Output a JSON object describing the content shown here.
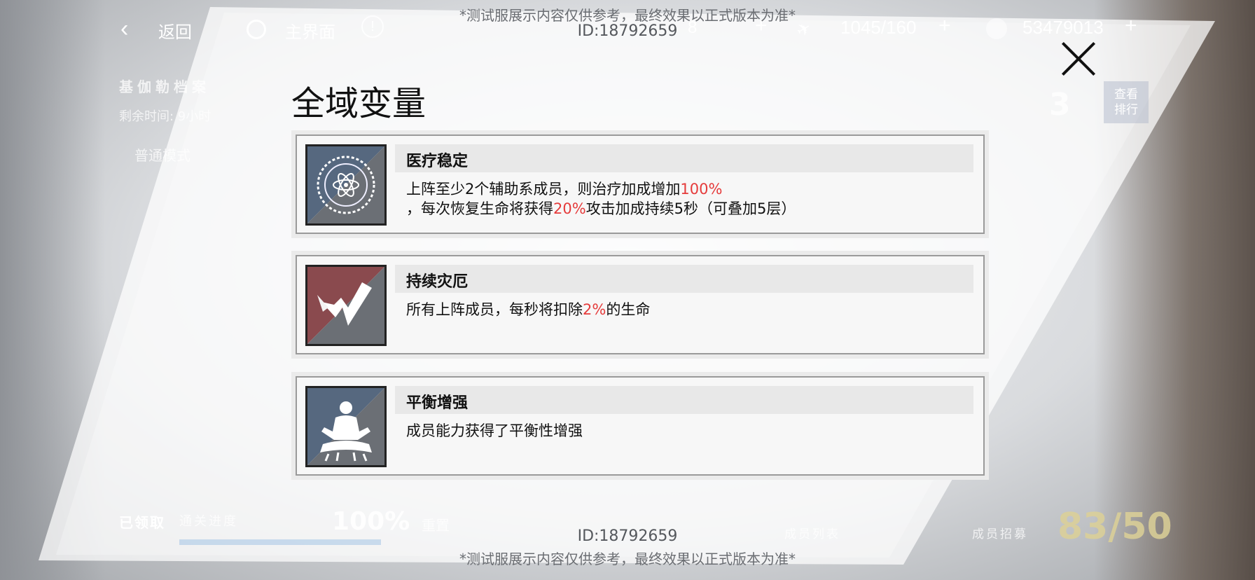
{
  "topbar": {
    "back_label": "返回",
    "home_label": "主界面",
    "res_a": "8",
    "res_b": "1045/160",
    "res_c": "53479013"
  },
  "watermark": {
    "notice": "*测试服展示内容仅供参考，最终效果以正式版本为准*",
    "id": "ID:18792659"
  },
  "background": {
    "archive_title": "基伽勒档案",
    "remaining_time": "剩余时间: 9小时",
    "mode": "普通模式",
    "rank_number": "3",
    "rank_button": "查看\n排行",
    "claimed": "已领取",
    "progress_label": "通关进度",
    "progress_value": "100%",
    "progress_fraction": 1.0,
    "reset": "重置",
    "member_list": "成员列表",
    "recruit_label": "成员招募",
    "recruit_count": "83/50"
  },
  "modal": {
    "title": "全域变量",
    "cards": [
      {
        "name": "医疗稳定",
        "icon": "atom-burst-icon",
        "line1_pre": "上阵至少2个辅助系成员，则治疗加成增加",
        "line1_hl": "100%",
        "line2_pre": "，每次恢复生命将获得",
        "line2_hl": "20%",
        "line2_post": "攻击加成持续5秒（可叠加5层）"
      },
      {
        "name": "持续灾厄",
        "icon": "broken-heart-icon",
        "line1_pre": "所有上阵成员，每秒将扣除",
        "line1_hl": "2%",
        "line1_post": "的生命"
      },
      {
        "name": "平衡增强",
        "icon": "meditation-figure-icon",
        "line1_pre": "成员能力获得了平衡性增强"
      }
    ]
  },
  "colors": {
    "highlight": "#e53b3b",
    "card_bg": "#f7f7f7",
    "name_bar": "#e8e8e8"
  }
}
